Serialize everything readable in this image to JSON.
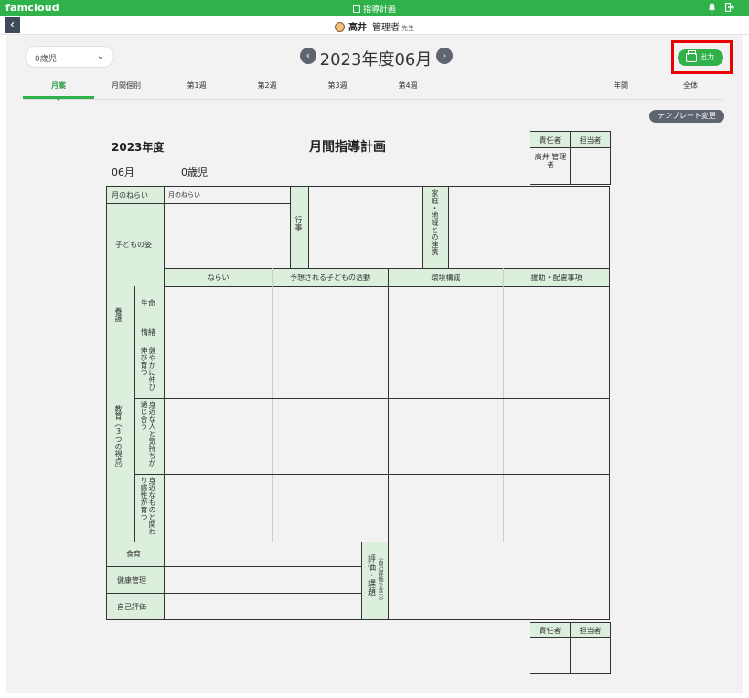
{
  "app": {
    "brand": "famcloud",
    "title": "指導計画",
    "icons": {
      "notifications": "bell-icon",
      "logout": "logout-icon",
      "back": "chevron-left-icon",
      "print": "printer-icon"
    },
    "brand_color": "#2fb24a"
  },
  "user": {
    "name": "高井",
    "role": "管理者",
    "role_suffix": "先生"
  },
  "toolbar": {
    "age_select": "0歳児",
    "month_title": "2023年度06月",
    "print_label": "出力",
    "template_button": "テンプレート変更"
  },
  "tabs": [
    {
      "label": "月案",
      "active": true
    },
    {
      "label": "月間個別",
      "active": false
    },
    {
      "label": "第1週",
      "active": false
    },
    {
      "label": "第2週",
      "active": false
    },
    {
      "label": "第3週",
      "active": false
    },
    {
      "label": "第4週",
      "active": false
    },
    {
      "label": "年間",
      "active": false
    },
    {
      "label": "全体",
      "active": false
    }
  ],
  "document": {
    "year": "2023年度",
    "title": "月間指導計画",
    "month": "06月",
    "class": "0歳児",
    "approval": {
      "head": "責任者",
      "staff": "担当者",
      "head_name": "高井 管理者"
    },
    "labels": {
      "monthly_aim": "月のねらい",
      "monthly_aim_value": "月のねらい",
      "child_status": "子どもの姿",
      "events": "行事",
      "family": "家庭・地域との連携",
      "col_aim": "ねらい",
      "col_activity": "予想される子どもの活動",
      "col_environment": "環境構成",
      "col_support": "援助・配慮事項",
      "nursing": "養護",
      "life": "生命",
      "emotion": "情緒",
      "education": "教育（3つの視点）",
      "edu1": "健やかに伸び伸び育つ",
      "edu2": "身近な人と気持ちが通じ合う",
      "edu3": "身近なものと関わり感性が育つ",
      "food": "食育",
      "health": "健康管理",
      "self_eval": "自己評価",
      "evaluation": "評価・課題",
      "evaluation_sub": "（自己評価を含む）"
    }
  }
}
